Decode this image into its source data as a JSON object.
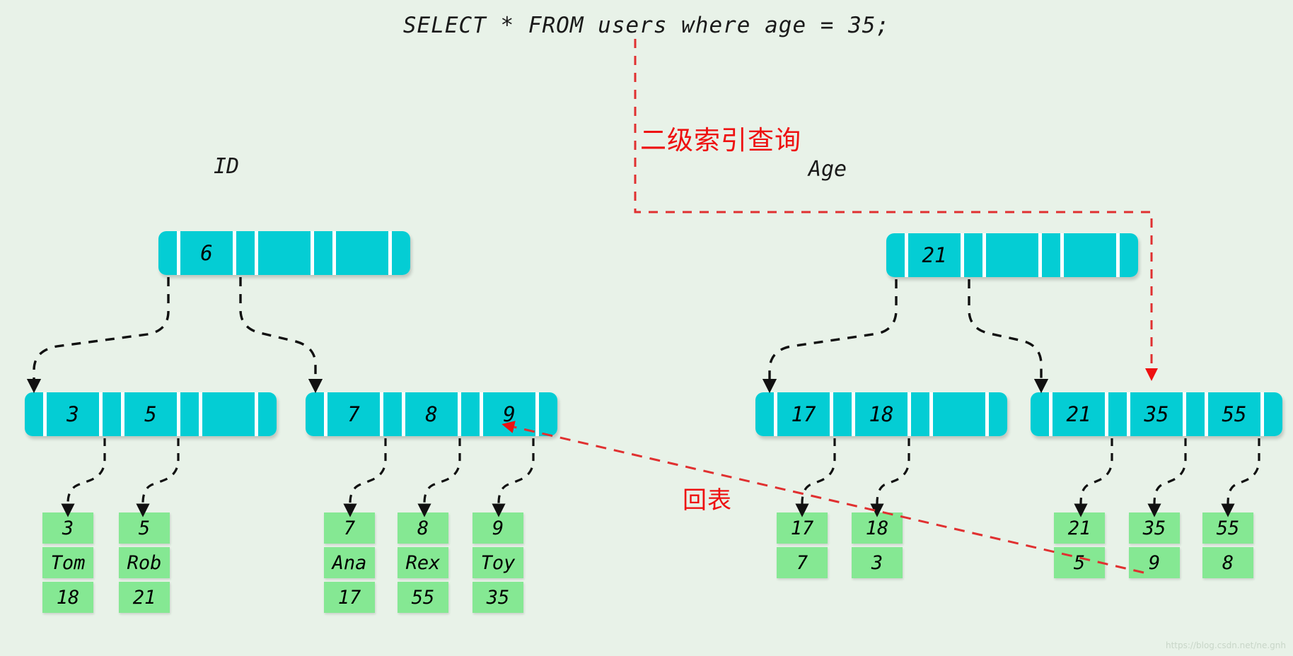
{
  "query": {
    "sql": "SELECT * FROM users where age = 35;"
  },
  "annotations": {
    "secondary_index_lookup": "二级索引查询",
    "back_to_table": "回表"
  },
  "colors": {
    "background": "#e8f2e8",
    "index_node": "#04cdd4",
    "data_block": "#85e893",
    "highlight": "#ee1111",
    "text": "#000000"
  },
  "trees": [
    {
      "name": "id-tree",
      "label": "ID",
      "root": {
        "keys": [
          "6",
          "",
          ""
        ]
      },
      "internal": [
        {
          "keys": [
            "3",
            "5",
            ""
          ]
        },
        {
          "keys": [
            "7",
            "8",
            "9"
          ]
        }
      ],
      "records": [
        {
          "cells": [
            "3",
            "Tom",
            "18"
          ]
        },
        {
          "cells": [
            "5",
            "Rob",
            "21"
          ]
        },
        {
          "cells": [
            "7",
            "Ana",
            "17"
          ]
        },
        {
          "cells": [
            "8",
            "Rex",
            "55"
          ]
        },
        {
          "cells": [
            "9",
            "Toy",
            "35"
          ]
        }
      ]
    },
    {
      "name": "age-tree",
      "label": "Age",
      "root": {
        "keys": [
          "21",
          "",
          ""
        ]
      },
      "internal": [
        {
          "keys": [
            "17",
            "18",
            ""
          ]
        },
        {
          "keys": [
            "21",
            "35",
            "55"
          ]
        }
      ],
      "records": [
        {
          "cells": [
            "17",
            "7"
          ]
        },
        {
          "cells": [
            "18",
            "3"
          ]
        },
        {
          "cells": [
            "21",
            "5"
          ]
        },
        {
          "cells": [
            "35",
            "9"
          ]
        },
        {
          "cells": [
            "55",
            "8"
          ]
        }
      ]
    }
  ],
  "watermark": "https://blog.csdn.net/ne.gnh"
}
